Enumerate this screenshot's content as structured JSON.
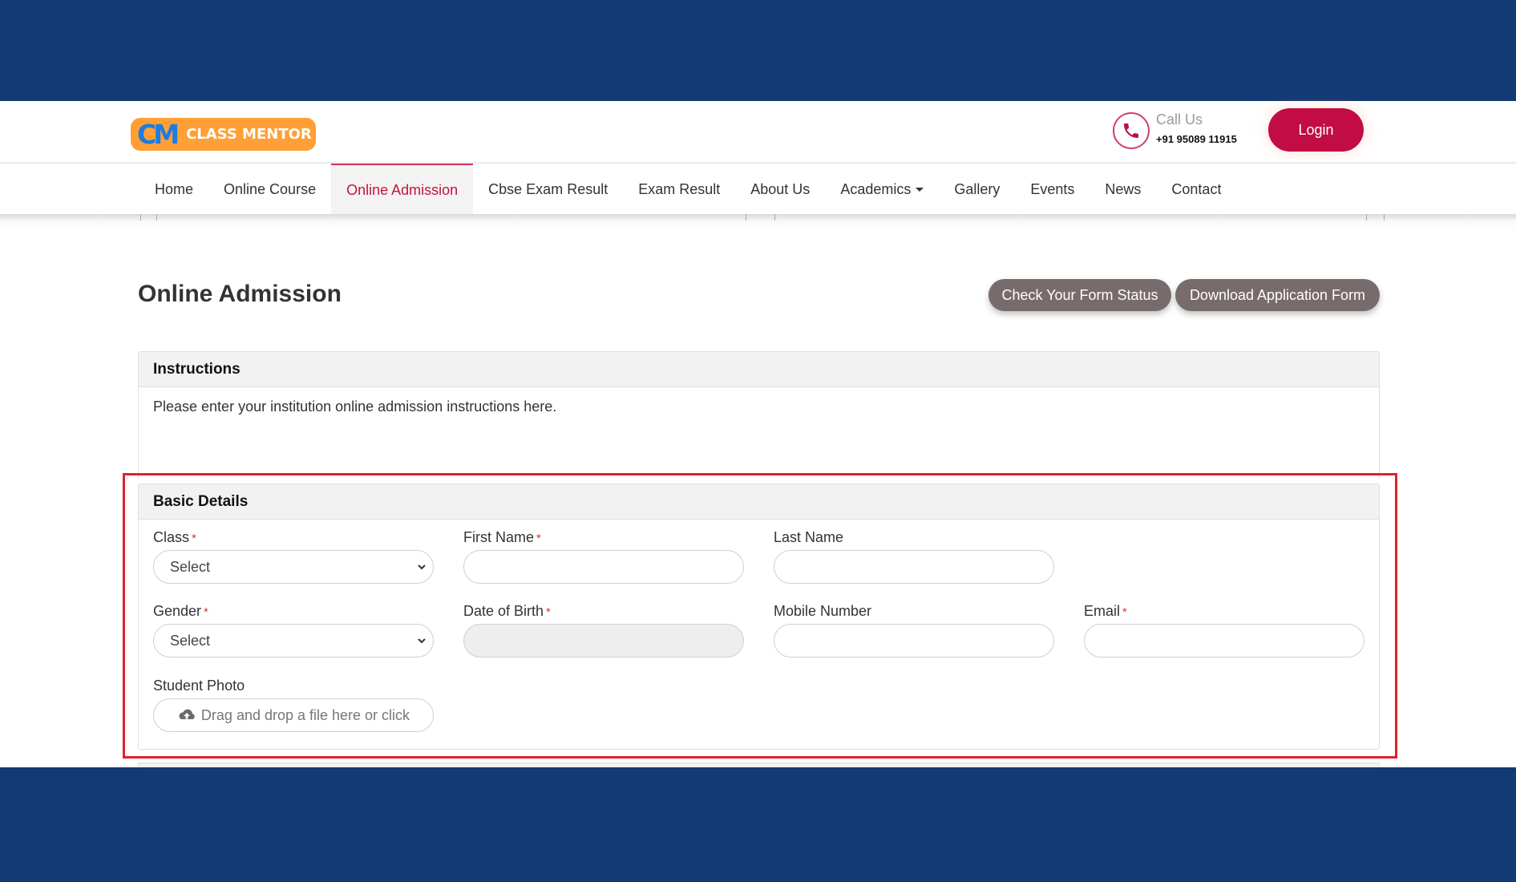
{
  "header": {
    "logo_mark": "CM",
    "logo_text": "CLASS MENTOR",
    "call_label": "Call Us",
    "call_number": "+91 95089 11915",
    "login_label": "Login",
    "icons": {
      "phone": "phone-icon"
    }
  },
  "nav": {
    "items": [
      {
        "label": "Home",
        "active": false
      },
      {
        "label": "Online Course",
        "active": false
      },
      {
        "label": "Online Admission",
        "active": true
      },
      {
        "label": "Cbse Exam Result",
        "active": false
      },
      {
        "label": "Exam Result",
        "active": false
      },
      {
        "label": "About Us",
        "active": false
      },
      {
        "label": "Academics",
        "active": false,
        "dropdown": true
      },
      {
        "label": "Gallery",
        "active": false
      },
      {
        "label": "Events",
        "active": false
      },
      {
        "label": "News",
        "active": false
      },
      {
        "label": "Contact",
        "active": false
      }
    ]
  },
  "page": {
    "title": "Online Admission",
    "check_status_label": "Check Your Form Status",
    "download_form_label": "Download Application Form"
  },
  "instructions": {
    "heading": "Instructions",
    "text": "Please enter your institution online admission instructions here."
  },
  "basic_details": {
    "heading": "Basic Details",
    "required_marker": "*",
    "fields": {
      "class": {
        "label": "Class",
        "required": true,
        "value": "Select"
      },
      "first_name": {
        "label": "First Name",
        "required": true,
        "value": ""
      },
      "last_name": {
        "label": "Last Name",
        "required": false,
        "value": ""
      },
      "gender": {
        "label": "Gender",
        "required": true,
        "value": "Select"
      },
      "dob": {
        "label": "Date of Birth",
        "required": true,
        "value": ""
      },
      "mobile": {
        "label": "Mobile Number",
        "required": false,
        "value": ""
      },
      "email": {
        "label": "Email",
        "required": true,
        "value": ""
      },
      "photo": {
        "label": "Student Photo",
        "required": false,
        "placeholder": "Drag and drop a file here or click"
      }
    }
  },
  "colors": {
    "brand_blue": "#133a74",
    "accent_red": "#c10c46",
    "logo_orange": "#ff9f35",
    "button_gray": "#786b6b",
    "highlight_red": "#e0212a"
  }
}
